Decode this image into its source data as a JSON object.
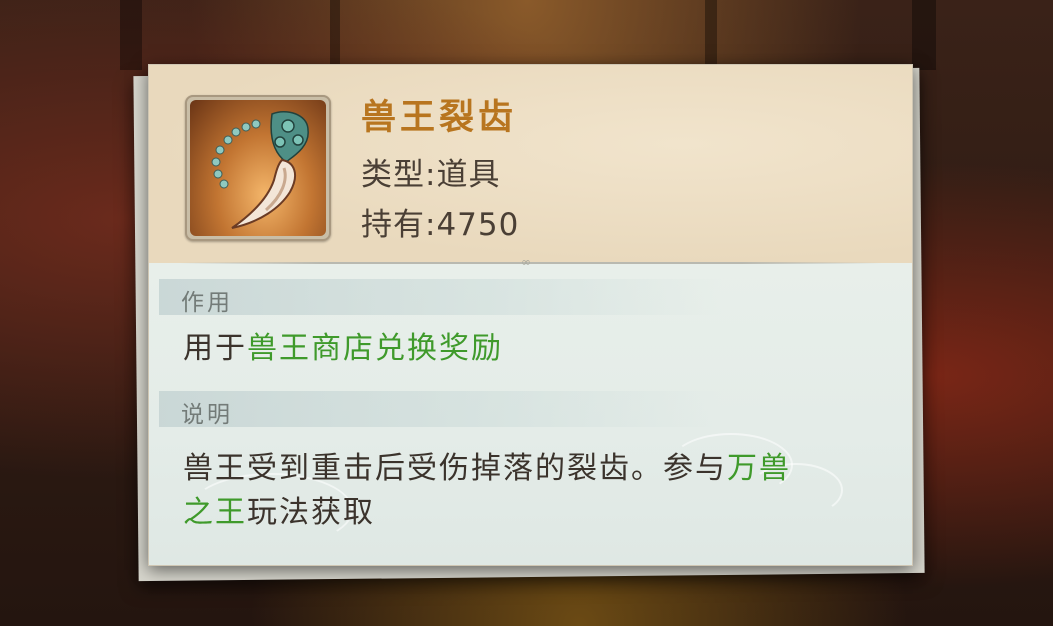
{
  "item": {
    "name": "兽王裂齿",
    "type_text": "类型:道具",
    "count_text": "持有:4750",
    "icon": "beast-fang-icon"
  },
  "usage": {
    "title": "作用",
    "text_prefix": "用于",
    "text_highlight": "兽王商店兑换奖励"
  },
  "description": {
    "title": "说明",
    "text_main": "兽王受到重击后受伤掉落的裂齿。参与",
    "text_highlight_1": "万兽",
    "text_highlight_2": "之王",
    "text_suffix": "玩法获取"
  },
  "colors": {
    "name": "#b8751f",
    "highlight": "#3f9a2b",
    "body_text": "#3b332c",
    "section_title": "#737b78"
  }
}
